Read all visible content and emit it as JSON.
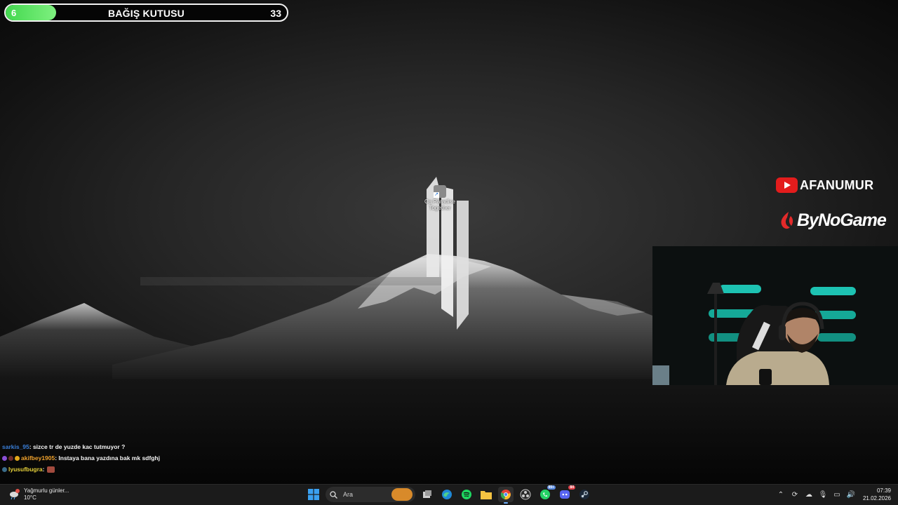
{
  "donation": {
    "title": "BAĞIŞ KUTUSU",
    "current": "6",
    "goal": "33",
    "progress_fraction": 0.18,
    "fill_color": "#4ee35a"
  },
  "desktop": {
    "shortcut_label": "Ca Paradise Together"
  },
  "branding": {
    "youtube_name": "AFANUMUR",
    "sponsor_name": "ByNoGame",
    "youtube_color": "#e31c1c"
  },
  "chat": {
    "messages": [
      {
        "user": "sarkis_95",
        "text": ": sizce tr de yuzde kac tutmuyor ?"
      },
      {
        "user": "akifbey1905",
        "text": ": Instaya bana yazdına bak mk sdfghj"
      },
      {
        "user": "lyusufbugra",
        "text": ":"
      }
    ]
  },
  "taskbar": {
    "weather": {
      "title": "Yağmurlu günler...",
      "temp": "10°C",
      "icon": "rain-cloud-icon",
      "badge": "1"
    },
    "search_placeholder": "Ara",
    "apps": [
      "start-icon",
      "search-icon",
      "task-view-icon",
      "edge-icon",
      "spotify-icon",
      "file-explorer-icon",
      "chrome-icon",
      "obs-icon",
      "whatsapp-icon",
      "discord-icon",
      "steam-icon"
    ],
    "whatsapp_badge": "99+",
    "discord_badge": "84",
    "clock": {
      "time": "07:39",
      "date": "21.02.2026"
    }
  }
}
